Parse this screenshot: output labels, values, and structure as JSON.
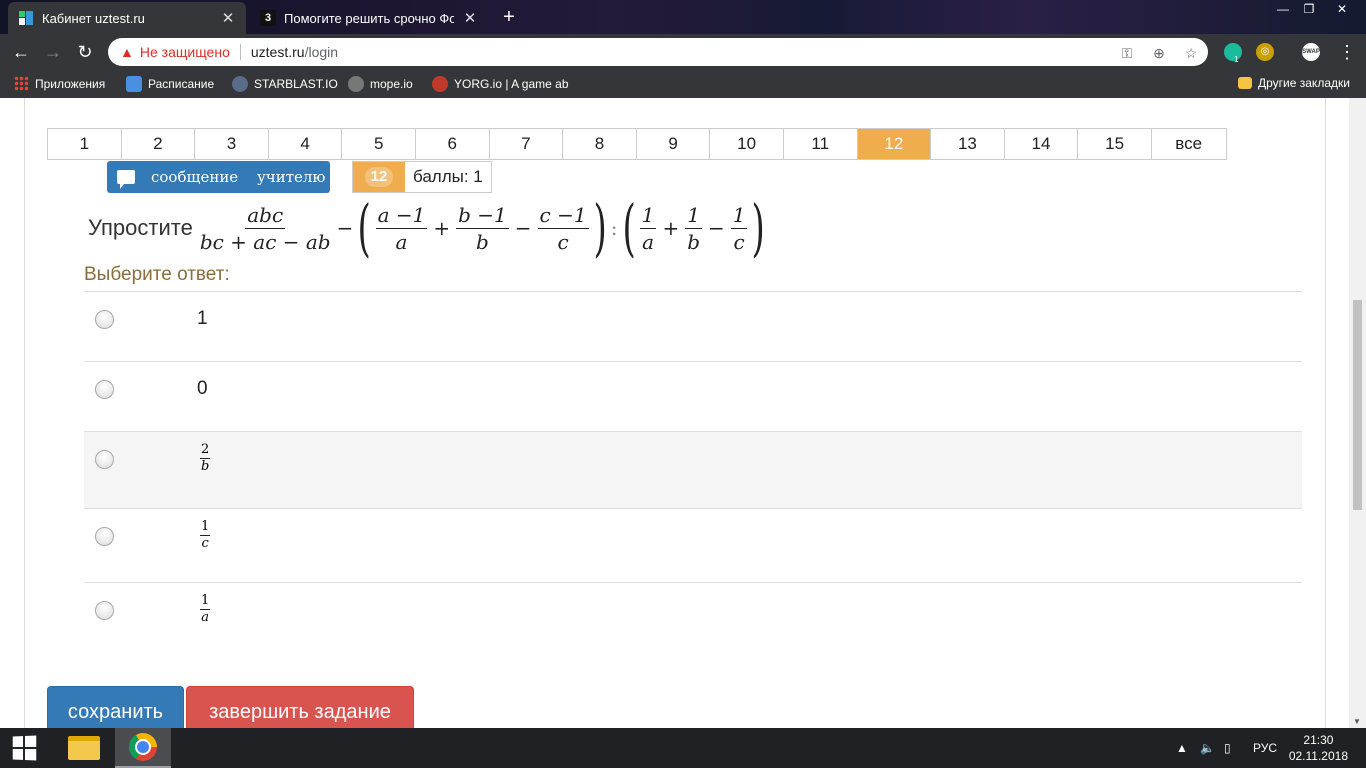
{
  "browser": {
    "tabs": [
      {
        "title": "Кабинет uztest.ru",
        "favicon": "uztest-favicon-icon",
        "active": true
      },
      {
        "title": "Помогите решить срочно Фото",
        "favicon_text": "3",
        "active": false
      }
    ],
    "address": {
      "warning": "Не защищено",
      "host": "uztest.ru",
      "path": "/login"
    },
    "bookmarks": [
      {
        "label": "Приложения",
        "icon": "apps-grid-icon"
      },
      {
        "label": "Расписание",
        "icon": "chat-icon"
      },
      {
        "label": "STARBLAST.IO",
        "icon": "ship-icon"
      },
      {
        "label": "mope.io",
        "icon": "mope-icon"
      },
      {
        "label": "YORG.io | A game ab",
        "icon": "yorg-icon"
      }
    ],
    "other_bookmarks": "Другие закладки",
    "extension_badge": "1",
    "swap_label": "SWAP"
  },
  "nav": {
    "items": [
      "1",
      "2",
      "3",
      "4",
      "5",
      "6",
      "7",
      "8",
      "9",
      "10",
      "11",
      "12",
      "13",
      "14",
      "15",
      "все"
    ],
    "active_index": 11
  },
  "message_button": "сообщение учителю",
  "score": {
    "question_number": "12",
    "points": "баллы: 1"
  },
  "question": {
    "prefix": "Упростите",
    "f1_num": "abc",
    "f1_den": "bc + ac − ab",
    "minus": "−",
    "f2_num": "a −1",
    "f2_den": "a",
    "plus1": "+",
    "f3_num": "b −1",
    "f3_den": "b",
    "minus2": "−",
    "f4_num": "c −1",
    "f4_den": "c",
    "colon": ":",
    "f5_num": "1",
    "f5_den": "a",
    "plus2": "+",
    "f6_num": "1",
    "f6_den": "b",
    "minus3": "−",
    "f7_num": "1",
    "f7_den": "c"
  },
  "choose_label": "Выберите ответ:",
  "answers": [
    {
      "value": "1"
    },
    {
      "value": "0"
    },
    {
      "num": "2",
      "den": "b"
    },
    {
      "num": "1",
      "den": "c"
    },
    {
      "num": "1",
      "den": "a"
    }
  ],
  "buttons": {
    "save": "сохранить",
    "finish": "завершить задание"
  },
  "taskbar": {
    "language": "РУС",
    "time": "21:30",
    "date": "02.11.2018"
  },
  "colors": {
    "active_nav": "#f0ad4e",
    "primary": "#337ab7",
    "danger": "#d9534f",
    "choose_label": "#8a6d3b"
  }
}
